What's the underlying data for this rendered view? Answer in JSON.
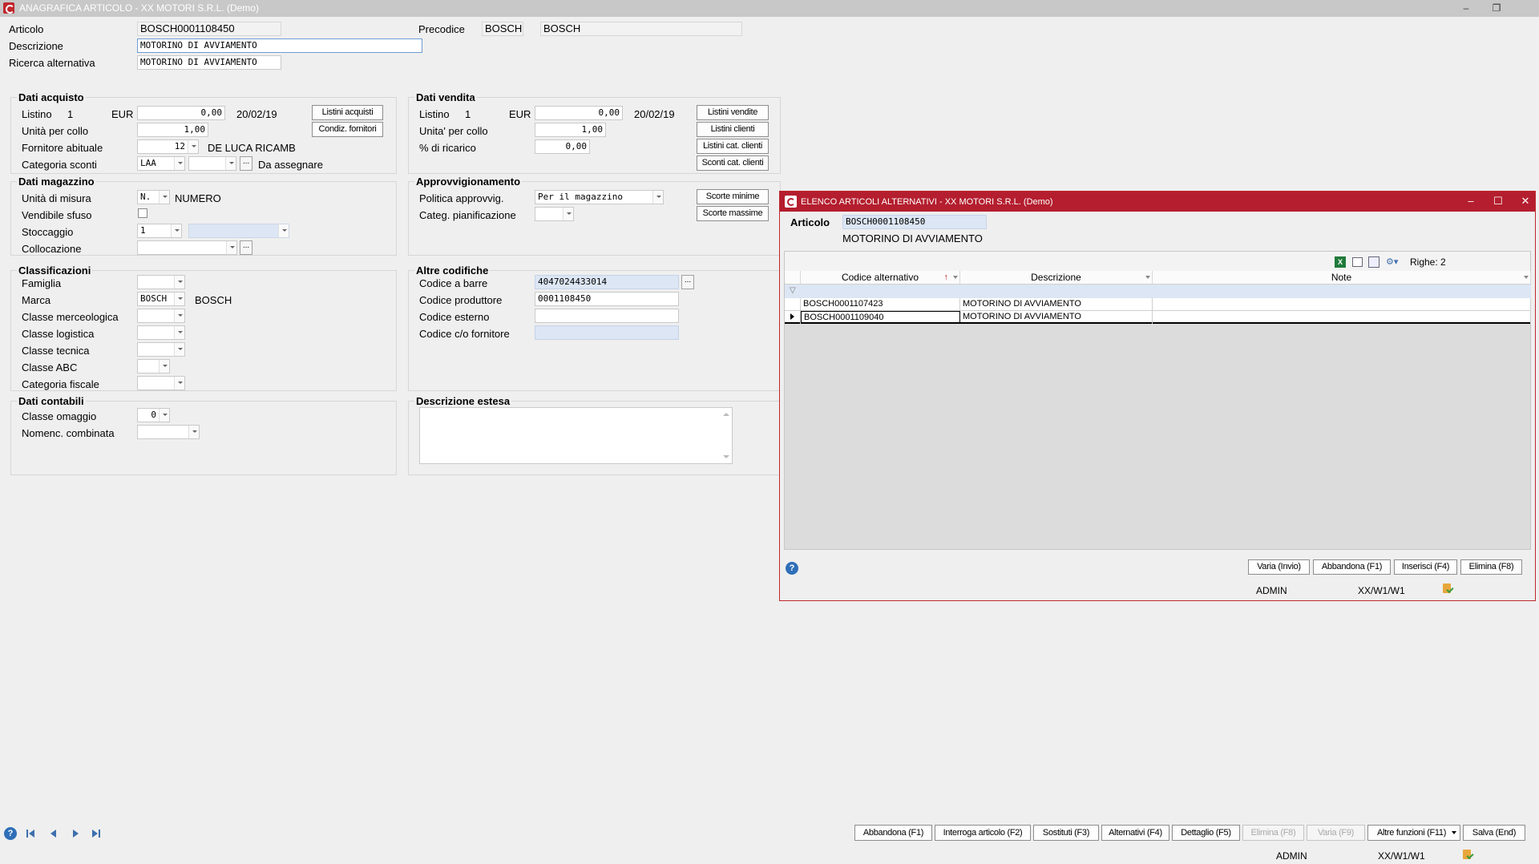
{
  "window": {
    "title": "ANAGRAFICA ARTICOLO - XX  MOTORI S.R.L.  (Demo)",
    "controls": [
      "–",
      "❐"
    ]
  },
  "header": {
    "articolo_label": "Articolo",
    "articolo_value": "BOSCH0001108450",
    "precodice_label": "Precodice",
    "precodice_value": "BOSCH",
    "precodice_desc": "BOSCH",
    "descrizione_label": "Descrizione",
    "descrizione_value": "MOTORINO DI AVVIAMENTO",
    "ricerca_label": "Ricerca alternativa",
    "ricerca_value": "MOTORINO DI AVVIAMENTO"
  },
  "acquisto": {
    "title": "Dati acquisto",
    "listino_label": "Listino",
    "listino_num": "1",
    "currency": "EUR",
    "listino_value": "0,00",
    "listino_date": "20/02/19",
    "unita_collo_label": "Unità per collo",
    "unita_collo_value": "1,00",
    "fornitore_label": "Fornitore abituale",
    "fornitore_value": "12",
    "fornitore_name": "DE LUCA RICAMB",
    "cat_sconti_label": "Categoria sconti",
    "cat_sconti_value": "LAA",
    "cat_sconti_desc": "Da assegnare",
    "btn_listini": "Listini acquisti",
    "btn_condiz": "Condiz. fornitori"
  },
  "vendita": {
    "title": "Dati vendita",
    "listino_label": "Listino",
    "listino_num": "1",
    "currency": "EUR",
    "listino_value": "0,00",
    "listino_date": "20/02/19",
    "unita_collo_label": "Unita' per collo",
    "unita_collo_value": "1,00",
    "ricarico_label": "% di ricarico",
    "ricarico_value": "0,00",
    "btn_listini_vendite": "Listini vendite",
    "btn_listini_clienti": "Listini clienti",
    "btn_listini_cat": "Listini cat. clienti",
    "btn_sconti_cat": "Sconti cat. clienti"
  },
  "magazzino": {
    "title": "Dati magazzino",
    "um_label": "Unità di misura",
    "um_value": "N.",
    "um_desc": "NUMERO",
    "sfuso_label": "Vendibile sfuso",
    "stoccaggio_label": "Stoccaggio",
    "stoccaggio_value": "1",
    "collocazione_label": "Collocazione"
  },
  "approvvigionamento": {
    "title": "Approvvigionamento",
    "politica_label": "Politica approvvig.",
    "politica_value": "Per il magazzino",
    "categ_label": "Categ. pianificazione",
    "btn_scorte_min": "Scorte minime",
    "btn_scorte_max": "Scorte massime"
  },
  "classificazioni": {
    "title": "Classificazioni",
    "famiglia_label": "Famiglia",
    "marca_label": "Marca",
    "marca_value": "BOSCH",
    "marca_desc": "BOSCH",
    "merceologica_label": "Classe merceologica",
    "logistica_label": "Classe logistica",
    "tecnica_label": "Classe tecnica",
    "abc_label": "Classe ABC",
    "fiscale_label": "Categoria fiscale"
  },
  "altre_codifiche": {
    "title": "Altre codifiche",
    "barre_label": "Codice a barre",
    "barre_value": "4047024433014",
    "produttore_label": "Codice produttore",
    "produttore_value": "0001108450",
    "esterno_label": "Codice esterno",
    "fornitore_label": "Codice c/o fornitore"
  },
  "contabili": {
    "title": "Dati contabili",
    "omaggio_label": "Classe omaggio",
    "omaggio_value": "0",
    "nomenc_label": "Nomenc. combinata"
  },
  "descrizione_estesa": {
    "title": "Descrizione estesa"
  },
  "footer": {
    "buttons": [
      {
        "label": "Abbandona (F1)",
        "enabled": true
      },
      {
        "label": "Interroga articolo (F2)",
        "enabled": true
      },
      {
        "label": "Sostituti (F3)",
        "enabled": true
      },
      {
        "label": "Alternativi (F4)",
        "enabled": true
      },
      {
        "label": "Dettaglio (F5)",
        "enabled": true
      },
      {
        "label": "Elimina (F8)",
        "enabled": false
      },
      {
        "label": "Varia (F9)",
        "enabled": false
      },
      {
        "label": "Altre funzioni (F11)",
        "enabled": true
      },
      {
        "label": "Salva (End)",
        "enabled": true
      }
    ],
    "user": "ADMIN",
    "company": "XX/W1/W1"
  },
  "modal": {
    "title": "ELENCO ARTICOLI ALTERNATIVI - XX  MOTORI S.R.L.  (Demo)",
    "articolo_label": "Articolo",
    "articolo_value": "BOSCH0001108450",
    "articolo_desc": "MOTORINO DI AVVIAMENTO",
    "righe": "Righe: 2",
    "columns": [
      "Codice alternativo",
      "Descrizione",
      "Note"
    ],
    "rows": [
      {
        "codice": "BOSCH0001107423",
        "descrizione": "MOTORINO DI AVVIAMENTO",
        "note": ""
      },
      {
        "codice": "BOSCH0001109040",
        "descrizione": "MOTORINO DI AVVIAMENTO",
        "note": ""
      }
    ],
    "buttons": [
      "Varia (Invio)",
      "Abbandona (F1)",
      "Inserisci (F4)",
      "Elimina (F8)"
    ],
    "user": "ADMIN",
    "company": "XX/W1/W1"
  }
}
